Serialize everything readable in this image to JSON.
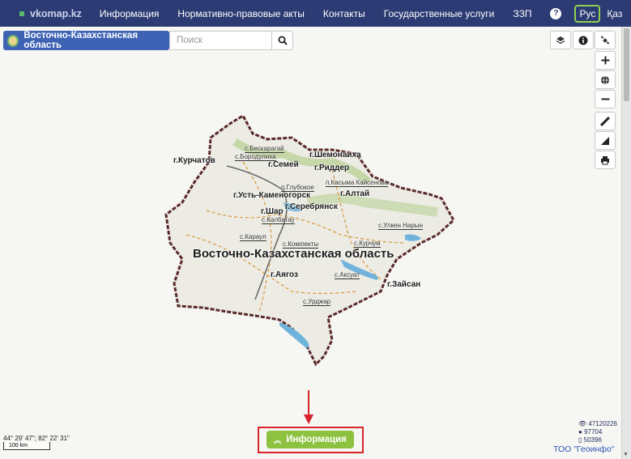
{
  "nav": {
    "brand": "vkomap.kz",
    "items": [
      "Информация",
      "Нормативно-правовые акты",
      "Контакты",
      "Государственные услуги",
      "ЗЗП"
    ],
    "help": "?",
    "lang_active": "Рус",
    "lang_other": "Қаз"
  },
  "toolbar": {
    "region": "Восточно-Казахстанская область",
    "search_placeholder": "Поиск"
  },
  "map": {
    "region_label": "Восточно-Казахстанская область",
    "cities": [
      "г.Курчатов",
      "г.Шемонаиха",
      "г.Семей",
      "г.Риддер",
      "г.Усть-Каменогорск",
      "г.Алтай",
      "г.Серебрянск",
      "г.Шар",
      "г.Аягоз",
      "г.Зайсан"
    ],
    "villages": [
      "с.Бескарагай",
      "с.Бородулиха",
      "п.Касыма Кайсенова",
      "п.Глубокое",
      "с.Калбатау",
      "с.Улкен Нарын",
      "с.Караул",
      "с.Коккпекты",
      "с.Курчум",
      "с.Аксуат",
      "с.Урджар"
    ]
  },
  "footer": {
    "coordinates": "44° 29' 47\"; 82° 22' 31\"",
    "scale": "100 km",
    "info_button": "Информация",
    "stat_views": "47120226",
    "stat_users": "97704",
    "stat_docs": "50396",
    "company": "ТОО \"Геоинфо\""
  },
  "colors": {
    "nav_bg": "#2c3b73",
    "region_btn": "#3e63b4",
    "info_btn": "#8cc23f",
    "highlight": "#d8232a",
    "lang_highlight": "#8fd14f"
  }
}
